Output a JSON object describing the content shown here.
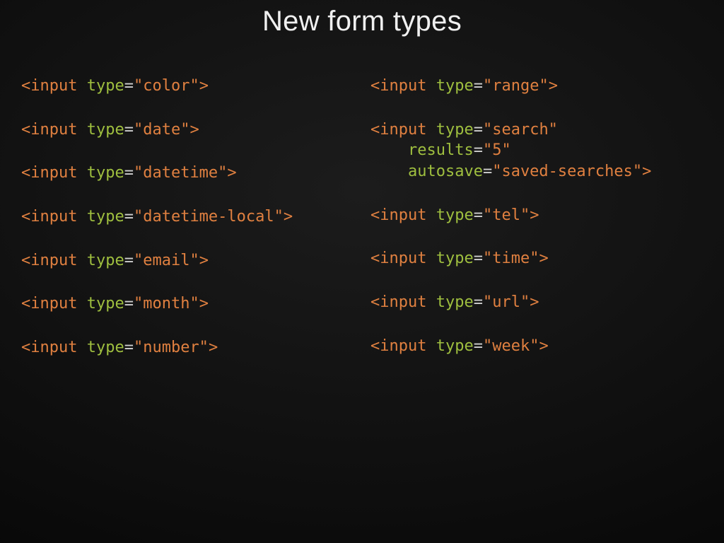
{
  "title": "New form types",
  "left": [
    [
      {
        "tag": "input",
        "attr": "type",
        "val": "\"color\""
      }
    ],
    [
      {
        "tag": "input",
        "attr": "type",
        "val": "\"date\""
      }
    ],
    [
      {
        "tag": "input",
        "attr": "type",
        "val": "\"datetime\""
      }
    ],
    [
      {
        "tag": "input",
        "attr": "type",
        "val": "\"datetime-local\""
      }
    ],
    [
      {
        "tag": "input",
        "attr": "type",
        "val": "\"email\""
      }
    ],
    [
      {
        "tag": "input",
        "attr": "type",
        "val": "\"month\""
      }
    ],
    [
      {
        "tag": "input",
        "attr": "type",
        "val": "\"number\""
      }
    ]
  ],
  "right": [
    [
      {
        "tag": "input",
        "attr": "type",
        "val": "\"range\""
      }
    ],
    [
      {
        "tag": "input",
        "attr": "type",
        "val": "\"search\"",
        "noclose": true
      },
      {
        "indent": "    ",
        "attr": "results",
        "val": "\"5\"",
        "noclose": true
      },
      {
        "indent": "    ",
        "attr": "autosave",
        "val": "\"saved-searches\""
      }
    ],
    [
      {
        "tag": "input",
        "attr": "type",
        "val": "\"tel\""
      }
    ],
    [
      {
        "tag": "input",
        "attr": "type",
        "val": "\"time\""
      }
    ],
    [
      {
        "tag": "input",
        "attr": "type",
        "val": "\"url\""
      }
    ],
    [
      {
        "tag": "input",
        "attr": "type",
        "val": "\"week\""
      }
    ]
  ]
}
